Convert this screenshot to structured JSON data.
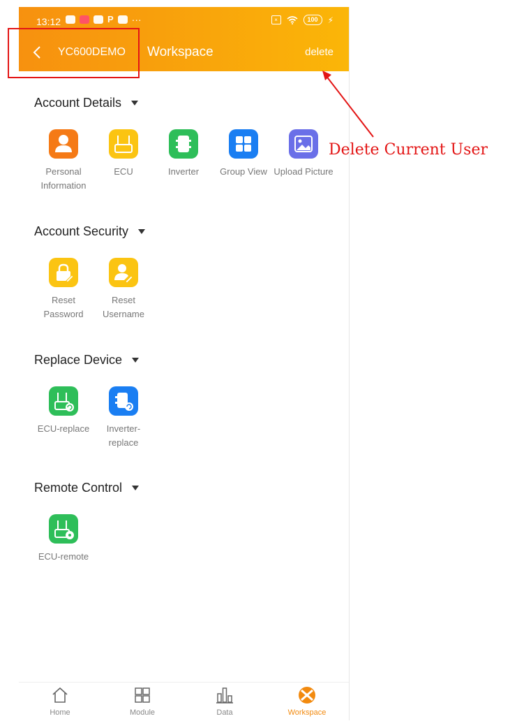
{
  "status": {
    "time": "13:12",
    "battery": "100"
  },
  "header": {
    "user": "YC600DEMO",
    "title": "Workspace",
    "delete_label": "delete"
  },
  "annotation": {
    "text": "Delete Current User",
    "color": "#e31515"
  },
  "sections": {
    "account_details": {
      "title": "Account Details",
      "items": [
        "Personal Information",
        "ECU",
        "Inverter",
        "Group View",
        "Upload Picture"
      ]
    },
    "account_security": {
      "title": "Account Security",
      "items": [
        "Reset Password",
        "Reset Username"
      ]
    },
    "replace_device": {
      "title": "Replace Device",
      "items": [
        "ECU-replace",
        "Inverter-replace"
      ]
    },
    "remote_control": {
      "title": "Remote Control",
      "items": [
        "ECU-remote"
      ]
    }
  },
  "tabbar": {
    "home": "Home",
    "module": "Module",
    "data": "Data",
    "workspace": "Workspace"
  },
  "colors": {
    "header": "#f7910f",
    "accent": "#f28a0f",
    "orange": "#f57a16",
    "yellow": "#fbc412",
    "green": "#2ebe59",
    "blue": "#1a7ef2",
    "purple": "#6a6fe8"
  }
}
